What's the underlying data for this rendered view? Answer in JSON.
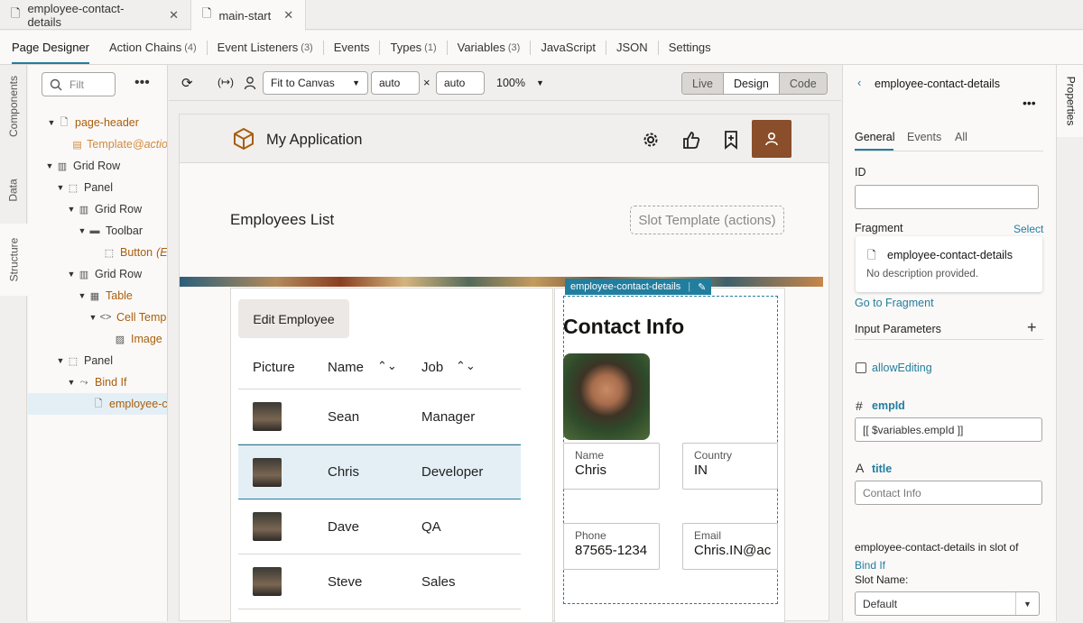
{
  "file_tabs": [
    {
      "label": "employee-contact-details"
    },
    {
      "label": "main-start"
    }
  ],
  "designer_tabs": [
    {
      "label": "Page Designer",
      "count": ""
    },
    {
      "label": "Action Chains",
      "count": "(4)"
    },
    {
      "label": "Event Listeners",
      "count": "(3)"
    },
    {
      "label": "Events",
      "count": ""
    },
    {
      "label": "Types",
      "count": "(1)"
    },
    {
      "label": "Variables",
      "count": "(3)"
    },
    {
      "label": "JavaScript",
      "count": ""
    },
    {
      "label": "JSON",
      "count": ""
    },
    {
      "label": "Settings",
      "count": ""
    }
  ],
  "left_vtabs": [
    "Components",
    "Data",
    "Structure"
  ],
  "filter_placeholder": "Filt",
  "tree": [
    {
      "label": "page-header",
      "extra": ""
    },
    {
      "label": "Template",
      "extra": "@actio"
    },
    {
      "label": "Grid Row",
      "extra": ""
    },
    {
      "label": "Panel",
      "extra": ""
    },
    {
      "label": "Grid Row",
      "extra": ""
    },
    {
      "label": "Toolbar",
      "extra": ""
    },
    {
      "label": "Button",
      "extra": "(E"
    },
    {
      "label": "Grid Row",
      "extra": ""
    },
    {
      "label": "Table",
      "extra": ""
    },
    {
      "label": "Cell Temp",
      "extra": ""
    },
    {
      "label": "Image",
      "extra": ""
    },
    {
      "label": "Panel",
      "extra": ""
    },
    {
      "label": "Bind If",
      "extra": ""
    },
    {
      "label": "employee-c",
      "extra": ""
    }
  ],
  "canvas_toolbar": {
    "fit": "Fit to Canvas",
    "width": "auto",
    "times": "×",
    "height": "auto",
    "zoom": "100%",
    "modes": [
      "Live",
      "Design",
      "Code"
    ]
  },
  "app": {
    "title": "My Application",
    "page_title": "Employees List",
    "slot_template": "Slot Template (actions)",
    "edit_button": "Edit Employee",
    "columns": [
      "Picture",
      "Name",
      "Job"
    ],
    "rows": [
      {
        "name": "Sean",
        "job": "Manager"
      },
      {
        "name": "Chris",
        "job": "Developer"
      },
      {
        "name": "Dave",
        "job": "QA"
      },
      {
        "name": "Steve",
        "job": "Sales"
      }
    ],
    "fragment_tag": "employee-contact-details",
    "contact_title": "Contact Info",
    "fields": {
      "name_label": "Name",
      "name_value": "Chris",
      "country_label": "Country",
      "country_value": "IN",
      "phone_label": "Phone",
      "phone_value": "87565-1234",
      "email_label": "Email",
      "email_value": "Chris.IN@ac"
    }
  },
  "properties": {
    "vtab": "Properties",
    "back_title": "employee-contact-details",
    "tabs": [
      "General",
      "Events",
      "All"
    ],
    "id_label": "ID",
    "id_value": "",
    "fragment_label": "Fragment",
    "select_link": "Select",
    "fragment_name": "employee-contact-details",
    "fragment_desc": "No description provided.",
    "go_to_fragment": "Go to Fragment",
    "input_params": "Input Parameters",
    "allow_editing": "allowEditing",
    "empid_label": "empId",
    "empid_value": "[[ $variables.empId ]]",
    "title_label": "title",
    "title_placeholder": "Contact Info",
    "slot_text": "employee-contact-details in slot of",
    "bind_if_link": "Bind If",
    "slot_name_label": "Slot Name:",
    "slot_name_value": "Default"
  },
  "colors": {
    "accent": "#227e9e",
    "brand": "#a85e0d"
  }
}
